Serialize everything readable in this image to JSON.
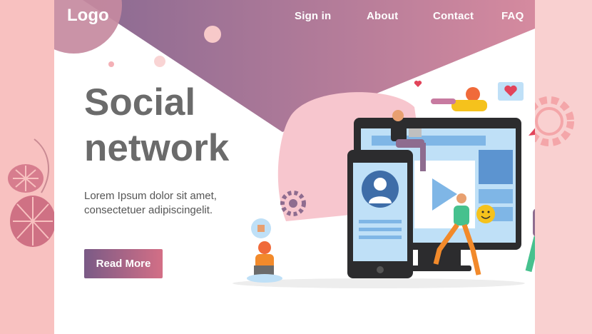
{
  "brand": {
    "logo_text": "Logo"
  },
  "nav": {
    "items": [
      {
        "label": "Sign in"
      },
      {
        "label": "About"
      },
      {
        "label": "Contact"
      },
      {
        "label": "FAQ"
      }
    ]
  },
  "hero": {
    "title_line1": "Social",
    "title_line2": "network",
    "subtitle_line1": "Lorem Ipsum dolor sit amet,",
    "subtitle_line2": "consectetuer adipiscingelit.",
    "cta_label": "Read More"
  },
  "colors": {
    "page_bg": "#f7b9b9",
    "band_start": "#8a6a92",
    "band_end": "#d58a9f",
    "title_gray": "#6b6b6b",
    "cta_start": "#7a5a86",
    "cta_end": "#d36f86",
    "accent_blue": "#3e6da8",
    "screen_blue": "#bfe0f7"
  },
  "icons": [
    "monstera-leaf-icon",
    "gear-icon",
    "heart-icon",
    "smiley-icon",
    "play-icon",
    "user-avatar-icon",
    "thumbs-up-icon"
  ]
}
